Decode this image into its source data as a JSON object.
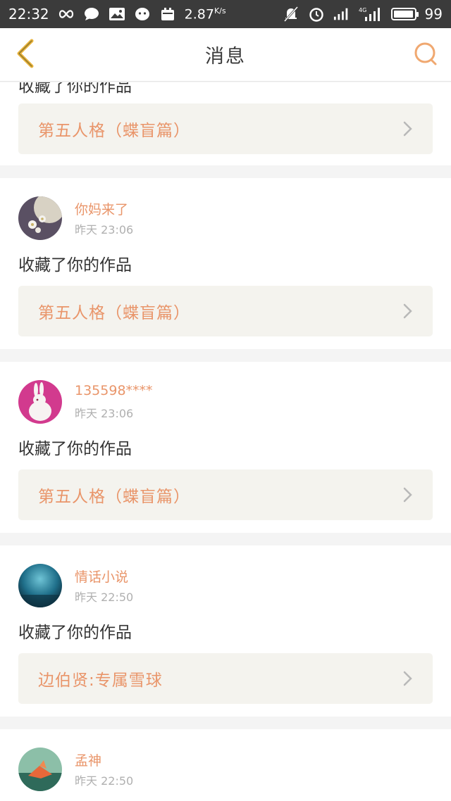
{
  "status_bar": {
    "time": "22:32",
    "net_speed": "2.87",
    "net_unit": "K/s",
    "network": "4G",
    "battery_level": "99",
    "battery_fraction": 0.99
  },
  "header": {
    "title": "消息",
    "back_icon": "chevron-left-icon",
    "search_icon": "search-icon"
  },
  "colors": {
    "accent": "#e9956a",
    "back_icon": "#e8b23a",
    "card_bg": "#f4f3ee"
  },
  "partial_top": {
    "action": "收藏了你的作品",
    "work_title": "第五人格（蝶盲篇）"
  },
  "messages": [
    {
      "username": "你妈来了",
      "time": "昨天 23:06",
      "action": "收藏了你的作品",
      "work_title": "第五人格（蝶盲篇）"
    },
    {
      "username": "135598****",
      "time": "昨天 23:06",
      "action": "收藏了你的作品",
      "work_title": "第五人格（蝶盲篇）"
    },
    {
      "username": "情话小说",
      "time": "昨天 22:50",
      "action": "收藏了你的作品",
      "work_title": "边伯贤:专属雪球"
    },
    {
      "username": "孟神",
      "time": "昨天 22:50"
    }
  ]
}
